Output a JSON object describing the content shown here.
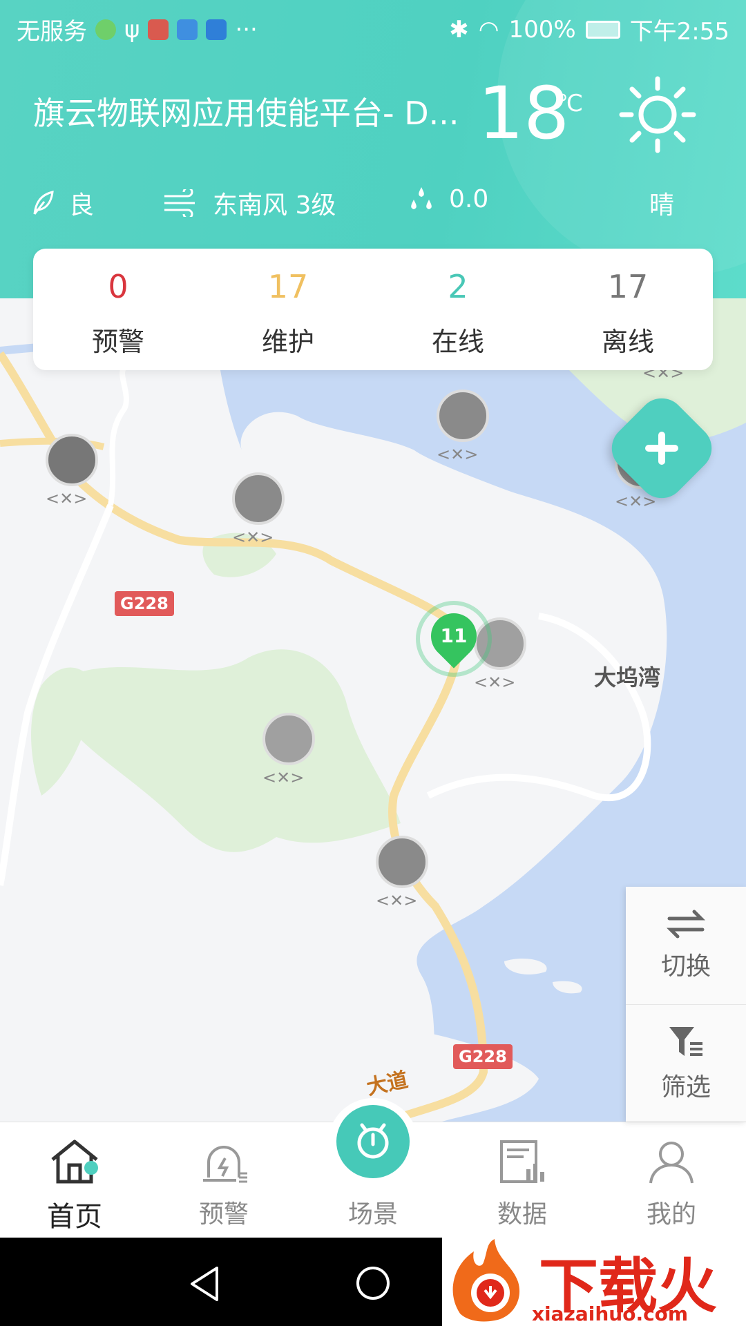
{
  "status_bar": {
    "carrier": "无服务",
    "more": "···",
    "battery": "100%",
    "time": "下午2:55"
  },
  "header": {
    "title": "旗云物联网应用使能平台- D...",
    "temperature": "18",
    "temp_unit": "℃",
    "air_quality": "良",
    "wind": "东南风 3级",
    "rainfall": "0.0",
    "weather": "晴"
  },
  "stats": [
    {
      "value": "0",
      "label": "预警",
      "color": "#d9363e"
    },
    {
      "value": "17",
      "label": "维护",
      "color": "#f0c060"
    },
    {
      "value": "2",
      "label": "在线",
      "color": "#48c7b6"
    },
    {
      "value": "17",
      "label": "离线",
      "color": "#777777"
    }
  ],
  "map": {
    "road_label_1": "G228",
    "road_label_2": "G228",
    "place_label": "大坞湾",
    "road_name": "大道",
    "cluster_count": "11",
    "markers": [
      "pole-icon",
      "pole-icon",
      "pole-icon",
      "pole-icon",
      "machine-icon",
      "funnel-icon",
      "car-icon",
      "car-icon"
    ]
  },
  "side_panel": {
    "switch_label": "切换",
    "filter_label": "筛选"
  },
  "tabs": [
    {
      "label": "首页",
      "icon": "home-icon",
      "active": true
    },
    {
      "label": "预警",
      "icon": "alarm-icon",
      "active": false
    },
    {
      "label": "场景",
      "icon": "scene-icon",
      "active": false
    },
    {
      "label": "数据",
      "icon": "data-icon",
      "active": false
    },
    {
      "label": "我的",
      "icon": "profile-icon",
      "active": false
    }
  ],
  "watermark": {
    "text": "下载火",
    "url": "xiazaihuo.com"
  },
  "colors": {
    "accent": "#4fcfbf",
    "warning": "#d9363e",
    "maintenance": "#f0c060",
    "water": "#c6d9f5",
    "park": "#dff0d9",
    "road": "#f7dea0"
  }
}
